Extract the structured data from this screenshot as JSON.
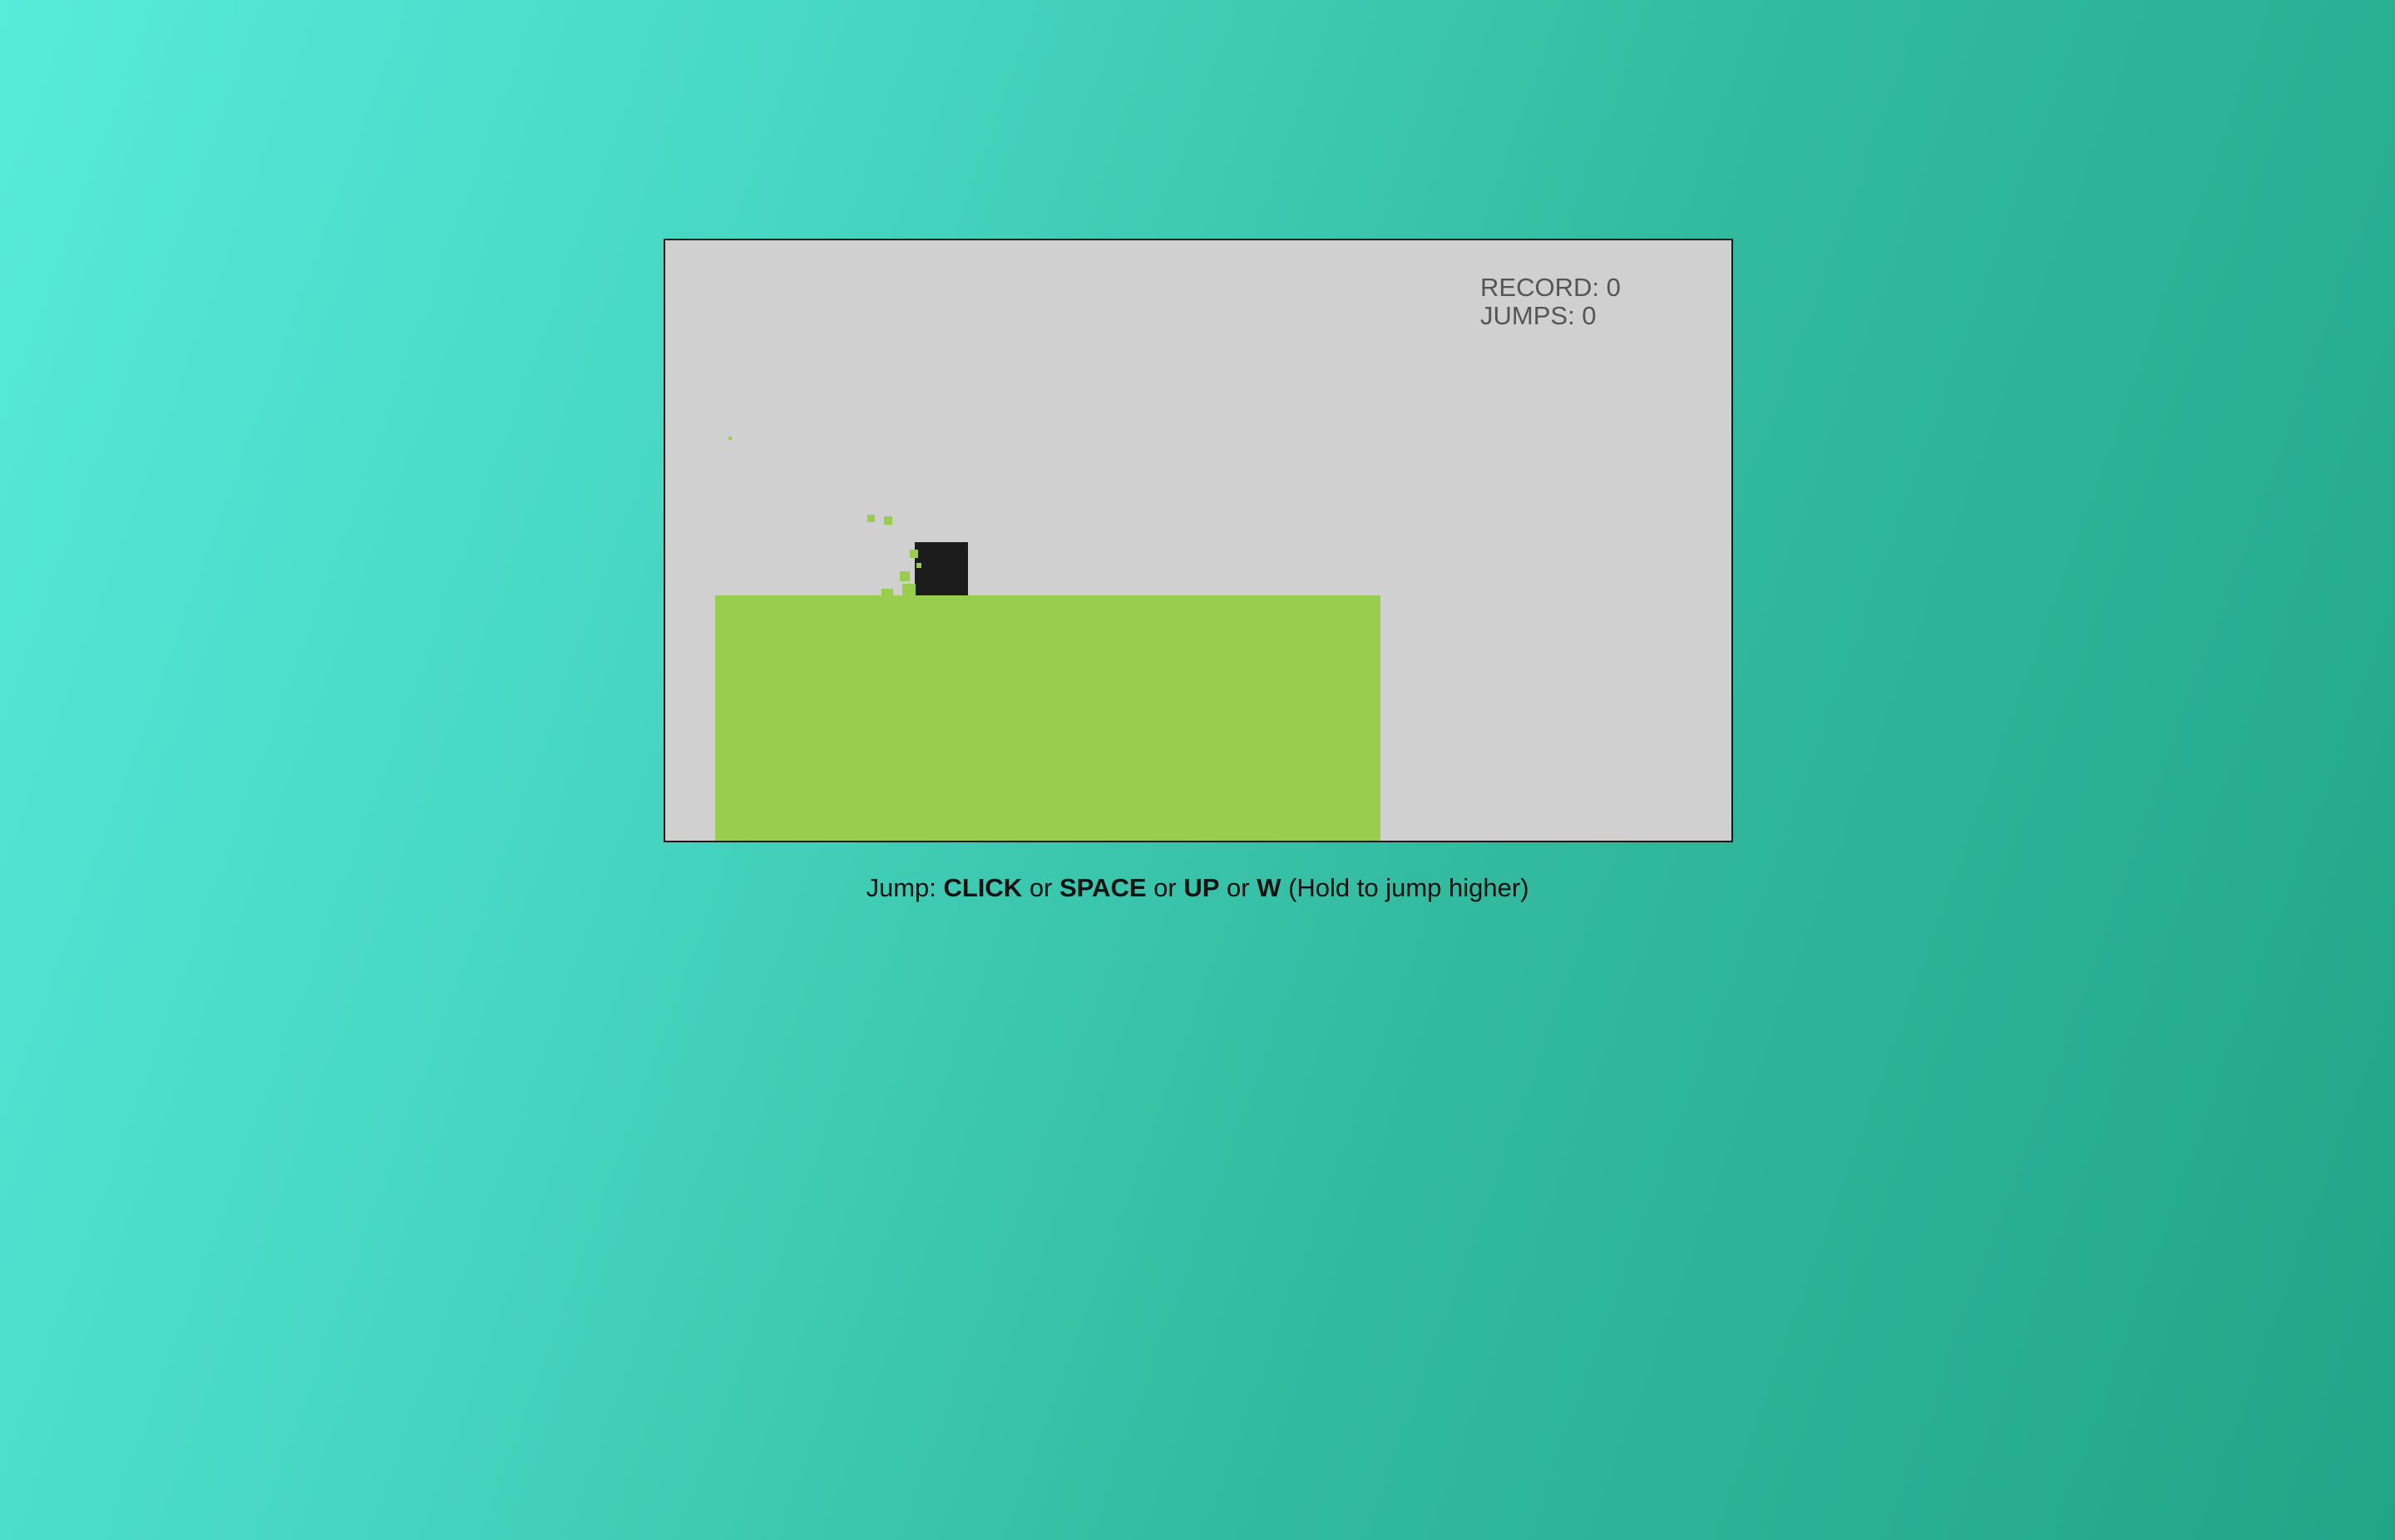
{
  "hud": {
    "record": "RECORD: 0",
    "jumps": "JUMPS: 0"
  },
  "instructions": {
    "prefix": "Jump: ",
    "key1": "CLICK",
    "sep1": " or ",
    "key2": "SPACE",
    "sep2": " or ",
    "key3": "UP",
    "sep3": " or ",
    "key4": "W",
    "suffix": " (Hold to jump higher)"
  },
  "colors": {
    "canvas_bg": "#d0d0d0",
    "platform": "#99cd4e",
    "player": "#1c1c1c",
    "hud_text": "#555555"
  }
}
